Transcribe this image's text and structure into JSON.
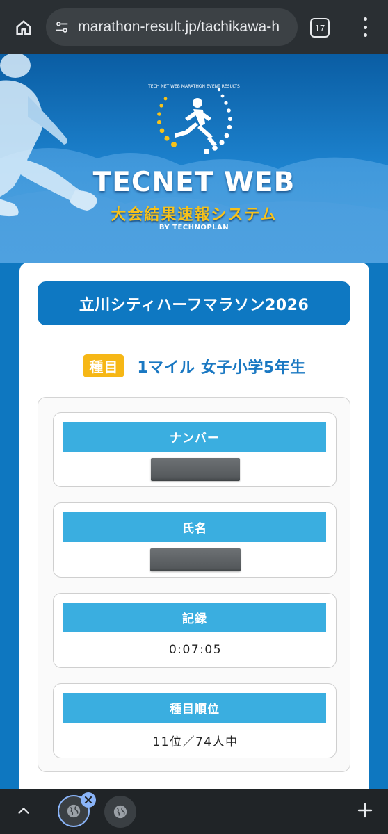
{
  "browser": {
    "url": "marathon-result.jp/tachikawa-h",
    "tab_count": "17"
  },
  "hero": {
    "logo_title": "TECNET WEB",
    "logo_subtitle": "大会結果速報システム",
    "logo_by": "BY TECHNOPLAN",
    "logo_ring_text": "TECH NET WEB MARATHON EVENT RESULTS"
  },
  "event": {
    "title": "立川シティハーフマラソン2026",
    "category_badge": "種目",
    "category": "1マイル 女子小学5年生"
  },
  "records": [
    {
      "label": "ナンバー",
      "value": "",
      "redacted": true
    },
    {
      "label": "氏名",
      "value": "",
      "redacted": true
    },
    {
      "label": "記録",
      "value": "0:07:05",
      "redacted": false
    },
    {
      "label": "種目順位",
      "value": "11位／74人中",
      "redacted": false
    }
  ],
  "colors": {
    "brand_blue": "#0e78c2",
    "header_cyan": "#3aaee0",
    "badge_yellow": "#f6b716",
    "logo_yellow": "#f7c21a"
  }
}
